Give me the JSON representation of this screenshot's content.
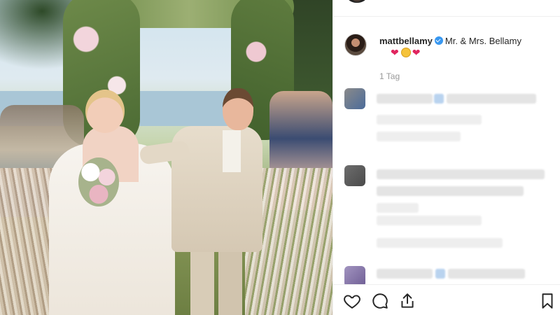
{
  "post": {
    "username": "mattbellamy",
    "verified": true,
    "caption_text": "Mr. & Mrs. Bellamy",
    "caption_emojis": [
      "❤",
      "😊",
      "❤"
    ],
    "time_ago": "1 Tag"
  },
  "photo": {
    "subject": "wedding-couple-photo"
  },
  "actions": {
    "icons": [
      "heart-icon",
      "comment-icon",
      "share-icon",
      "bookmark-icon"
    ]
  },
  "colors": {
    "verified_badge": "#3897f0",
    "text_primary": "#262626",
    "text_secondary": "#999999",
    "divider": "#efefef"
  }
}
